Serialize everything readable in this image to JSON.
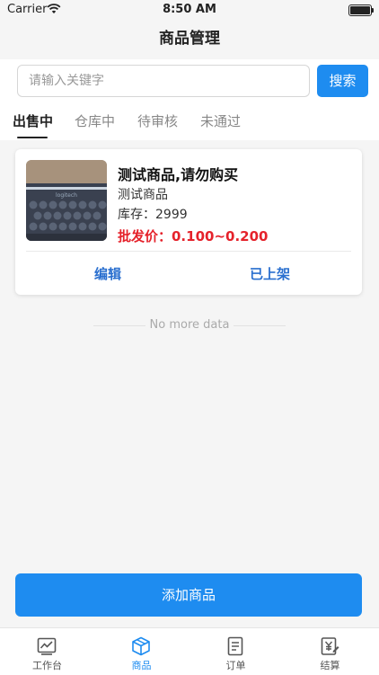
{
  "status_bar": {
    "carrier": "Carrier",
    "time": "8:50 AM"
  },
  "nav": {
    "title": "商品管理"
  },
  "search": {
    "placeholder": "请输入关键字",
    "button_label": "搜索"
  },
  "tabs": [
    {
      "label": "出售中",
      "active": true
    },
    {
      "label": "仓库中",
      "active": false
    },
    {
      "label": "待审核",
      "active": false
    },
    {
      "label": "未通过",
      "active": false
    }
  ],
  "products": [
    {
      "title": "测试商品,请勿购买",
      "subtitle": "测试商品",
      "stock": "库存：2999",
      "price": "批发价：0.100~0.200",
      "actions": [
        "编辑",
        "已上架"
      ]
    }
  ],
  "list_footer": "No more data",
  "add_button": "添加商品",
  "tabbar": [
    {
      "label": "工作台",
      "icon": "chart-icon",
      "active": false
    },
    {
      "label": "商品",
      "icon": "box-icon",
      "active": true
    },
    {
      "label": "订单",
      "icon": "document-icon",
      "active": false
    },
    {
      "label": "结算",
      "icon": "settlement-icon",
      "active": false
    }
  ],
  "colors": {
    "primary": "#1e8cf0",
    "price_red": "#e5222b",
    "action_blue": "#2a6fcf"
  }
}
